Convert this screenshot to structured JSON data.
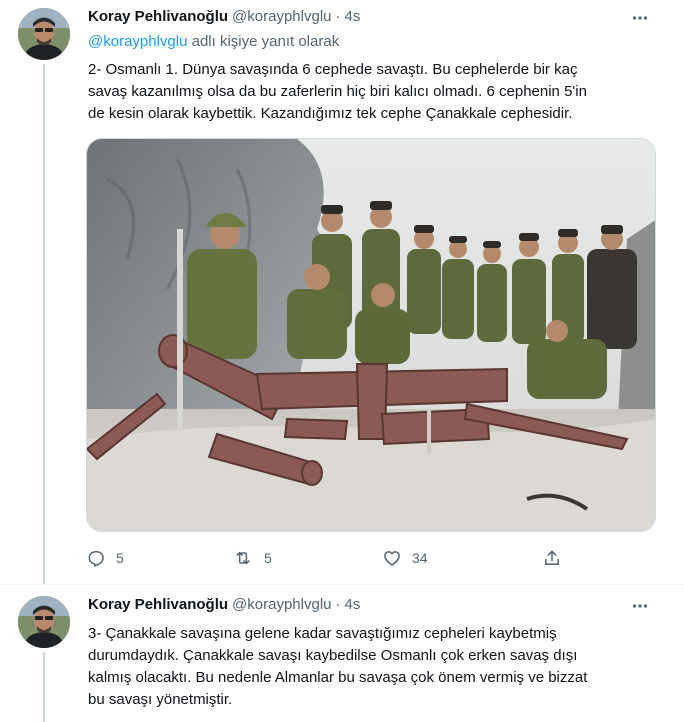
{
  "tweets": [
    {
      "author": {
        "name": "Koray Pehlivanoğlu",
        "handle": "@korayphlvglu"
      },
      "time": "4s",
      "reply_prefix": "",
      "reply_to": "@korayphlvglu",
      "reply_suffix": " adlı kişiye yanıt olarak",
      "text_lines": [
        "2- Osmanlı 1. Dünya savaşında 6 cephede savaştı. Bu cephelerde bir kaç",
        "savaş kazanılmış olsa da bu zaferlerin hiç biri kalıcı olmadı. 6 cephenin 5'in",
        "de kesin olarak kaybettik. Kazandığımız tek cephe Çanakkale cephesidir."
      ],
      "media": {
        "description_icon": "photo-image",
        "subject": "Ottoman officers posing with cannon barrels"
      },
      "actions": {
        "reply_count": "5",
        "retweet_count": "5",
        "like_count": "34"
      }
    },
    {
      "author": {
        "name": "Koray Pehlivanoğlu",
        "handle": "@korayphlvglu"
      },
      "time": "4s",
      "text_lines": [
        "3-  Çanakkale savaşına gelene kadar savaştığımız cepheleri kaybetmiş",
        "durumdaydık. Çanakkale savaşı kaybedilse Osmanlı çok erken savaş dışı",
        "kalmış olacaktı. Bu nedenle Almanlar bu savaşa çok önem vermiş ve bizzat",
        "bu savaşı yönetmiştir."
      ]
    }
  ],
  "colors": {
    "text_primary": "#0f1419",
    "text_secondary": "#536471",
    "link": "#1d9bf0",
    "thread_line": "#cfd9de",
    "divider": "#eff3f4"
  },
  "icons": {
    "reply": "speech-bubble-icon",
    "retweet": "retweet-arrows-icon",
    "like": "heart-icon",
    "share": "upload-share-icon",
    "more": "three-dots-icon"
  }
}
